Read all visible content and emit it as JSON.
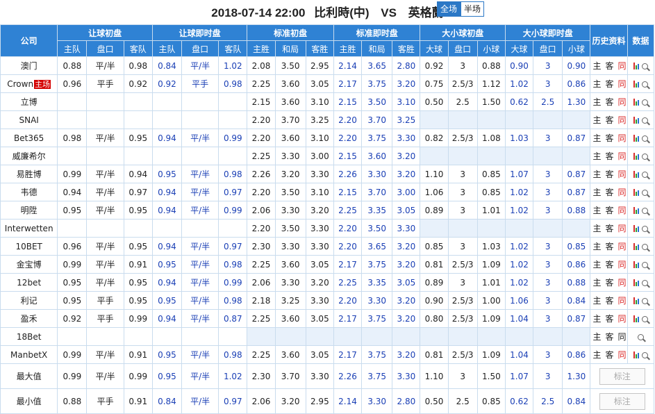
{
  "header": {
    "datetime": "2018-07-14 22:00",
    "home": "比利時(中)",
    "vs": "VS",
    "away": "英格蘭",
    "toggle_full": "全场",
    "toggle_half": "半场"
  },
  "columns": {
    "company": "公司",
    "group_handicap_init": "让球初盘",
    "group_handicap_live": "让球即时盘",
    "group_std_init": "标准初盘",
    "group_std_live": "标准即时盘",
    "group_ou_init": "大小球初盘",
    "group_ou_live": "大小球即时盘",
    "history": "历史资料",
    "data": "数据",
    "home_team": "主队",
    "line": "盘口",
    "away_team": "客队",
    "home_win": "主胜",
    "draw": "和局",
    "away_win": "客胜",
    "over": "大球",
    "under": "小球"
  },
  "history_labels": {
    "home": "主",
    "away": "客",
    "same": "同"
  },
  "rows": [
    {
      "company": "澳门",
      "hi": [
        "0.88",
        "平/半",
        "0.98"
      ],
      "hl": [
        "0.84",
        "平/半",
        "1.02"
      ],
      "si": [
        "2.08",
        "3.50",
        "2.95"
      ],
      "sl": [
        "2.14",
        "3.65",
        "2.80"
      ],
      "oi": [
        "0.92",
        "3",
        "0.88"
      ],
      "ol": [
        "0.90",
        "3",
        "0.90"
      ],
      "tong": true,
      "bars": true
    },
    {
      "company": "Crown",
      "tag": "主场",
      "hi": [
        "0.96",
        "平手",
        "0.92"
      ],
      "hl": [
        "0.92",
        "平手",
        "0.98"
      ],
      "si": [
        "2.25",
        "3.60",
        "3.05"
      ],
      "sl": [
        "2.17",
        "3.75",
        "3.20"
      ],
      "oi": [
        "0.75",
        "2.5/3",
        "1.12"
      ],
      "ol": [
        "1.02",
        "3",
        "0.86"
      ],
      "tong": true,
      "bars": true
    },
    {
      "company": "立博",
      "hi": [
        "",
        "",
        ""
      ],
      "hl": [
        "",
        "",
        ""
      ],
      "si": [
        "2.15",
        "3.60",
        "3.10"
      ],
      "sl": [
        "2.15",
        "3.50",
        "3.10"
      ],
      "oi": [
        "0.50",
        "2.5",
        "1.50"
      ],
      "ol": [
        "0.62",
        "2.5",
        "1.30"
      ],
      "tong": true,
      "bars": true
    },
    {
      "company": "SNAI",
      "hi": [
        "",
        "",
        ""
      ],
      "hl": [
        "",
        "",
        ""
      ],
      "si": [
        "2.20",
        "3.70",
        "3.25"
      ],
      "sl": [
        "2.20",
        "3.70",
        "3.25"
      ],
      "oi": [
        "",
        "",
        ""
      ],
      "ol": [
        "",
        "",
        ""
      ],
      "tong": true,
      "bars": true
    },
    {
      "company": "Bet365",
      "hi": [
        "0.98",
        "平/半",
        "0.95"
      ],
      "hl": [
        "0.94",
        "平/半",
        "0.99"
      ],
      "si": [
        "2.20",
        "3.60",
        "3.10"
      ],
      "sl": [
        "2.20",
        "3.75",
        "3.30"
      ],
      "oi": [
        "0.82",
        "2.5/3",
        "1.08"
      ],
      "ol": [
        "1.03",
        "3",
        "0.87"
      ],
      "tong": true,
      "bars": true
    },
    {
      "company": "威廉希尔",
      "hi": [
        "",
        "",
        ""
      ],
      "hl": [
        "",
        "",
        ""
      ],
      "si": [
        "2.25",
        "3.30",
        "3.00"
      ],
      "sl": [
        "2.15",
        "3.60",
        "3.20"
      ],
      "oi": [
        "",
        "",
        ""
      ],
      "ol": [
        "",
        "",
        ""
      ],
      "tong": true,
      "bars": true
    },
    {
      "company": "易胜博",
      "hi": [
        "0.99",
        "平/半",
        "0.94"
      ],
      "hl": [
        "0.95",
        "平/半",
        "0.98"
      ],
      "si": [
        "2.26",
        "3.20",
        "3.30"
      ],
      "sl": [
        "2.26",
        "3.30",
        "3.20"
      ],
      "oi": [
        "1.10",
        "3",
        "0.85"
      ],
      "ol": [
        "1.07",
        "3",
        "0.87"
      ],
      "tong": true,
      "bars": true
    },
    {
      "company": "韦德",
      "hi": [
        "0.94",
        "平/半",
        "0.97"
      ],
      "hl": [
        "0.94",
        "平/半",
        "0.97"
      ],
      "si": [
        "2.20",
        "3.50",
        "3.10"
      ],
      "sl": [
        "2.15",
        "3.70",
        "3.00"
      ],
      "oi": [
        "1.06",
        "3",
        "0.85"
      ],
      "ol": [
        "1.02",
        "3",
        "0.87"
      ],
      "tong": true,
      "bars": true
    },
    {
      "company": "明陞",
      "hi": [
        "0.95",
        "平/半",
        "0.95"
      ],
      "hl": [
        "0.94",
        "平/半",
        "0.99"
      ],
      "si": [
        "2.06",
        "3.30",
        "3.20"
      ],
      "sl": [
        "2.25",
        "3.35",
        "3.05"
      ],
      "oi": [
        "0.89",
        "3",
        "1.01"
      ],
      "ol": [
        "1.02",
        "3",
        "0.88"
      ],
      "tong": true,
      "bars": true
    },
    {
      "company": "Interwetten",
      "hi": [
        "",
        "",
        ""
      ],
      "hl": [
        "",
        "",
        ""
      ],
      "si": [
        "2.20",
        "3.50",
        "3.30"
      ],
      "sl": [
        "2.20",
        "3.50",
        "3.30"
      ],
      "oi": [
        "",
        "",
        ""
      ],
      "ol": [
        "",
        "",
        ""
      ],
      "tong": true,
      "bars": true
    },
    {
      "company": "10BET",
      "hi": [
        "0.96",
        "平/半",
        "0.95"
      ],
      "hl": [
        "0.94",
        "平/半",
        "0.97"
      ],
      "si": [
        "2.30",
        "3.30",
        "3.30"
      ],
      "sl": [
        "2.20",
        "3.65",
        "3.20"
      ],
      "oi": [
        "0.85",
        "3",
        "1.03"
      ],
      "ol": [
        "1.02",
        "3",
        "0.85"
      ],
      "tong": true,
      "bars": true
    },
    {
      "company": "金宝博",
      "hi": [
        "0.99",
        "平/半",
        "0.91"
      ],
      "hl": [
        "0.95",
        "平/半",
        "0.98"
      ],
      "si": [
        "2.25",
        "3.60",
        "3.05"
      ],
      "sl": [
        "2.17",
        "3.75",
        "3.20"
      ],
      "oi": [
        "0.81",
        "2.5/3",
        "1.09"
      ],
      "ol": [
        "1.02",
        "3",
        "0.86"
      ],
      "tong": true,
      "bars": true
    },
    {
      "company": "12bet",
      "hi": [
        "0.95",
        "平/半",
        "0.95"
      ],
      "hl": [
        "0.94",
        "平/半",
        "0.99"
      ],
      "si": [
        "2.06",
        "3.30",
        "3.20"
      ],
      "sl": [
        "2.25",
        "3.35",
        "3.05"
      ],
      "oi": [
        "0.89",
        "3",
        "1.01"
      ],
      "ol": [
        "1.02",
        "3",
        "0.88"
      ],
      "tong": true,
      "bars": true
    },
    {
      "company": "利记",
      "hi": [
        "0.95",
        "平手",
        "0.95"
      ],
      "hl": [
        "0.95",
        "平/半",
        "0.98"
      ],
      "si": [
        "2.18",
        "3.25",
        "3.30"
      ],
      "sl": [
        "2.20",
        "3.30",
        "3.20"
      ],
      "oi": [
        "0.90",
        "2.5/3",
        "1.00"
      ],
      "ol": [
        "1.06",
        "3",
        "0.84"
      ],
      "tong": true,
      "bars": true
    },
    {
      "company": "盈禾",
      "hi": [
        "0.92",
        "平手",
        "0.99"
      ],
      "hl": [
        "0.94",
        "平/半",
        "0.87"
      ],
      "si": [
        "2.25",
        "3.60",
        "3.05"
      ],
      "sl": [
        "2.17",
        "3.75",
        "3.20"
      ],
      "oi": [
        "0.80",
        "2.5/3",
        "1.09"
      ],
      "ol": [
        "1.04",
        "3",
        "0.87"
      ],
      "tong": true,
      "bars": true
    },
    {
      "company": "18Bet",
      "hi": [
        "",
        "",
        ""
      ],
      "hl": [
        "",
        "",
        ""
      ],
      "si": [
        "",
        "",
        ""
      ],
      "sl": [
        "",
        "",
        ""
      ],
      "oi": [
        "",
        "",
        ""
      ],
      "ol": [
        "",
        "",
        ""
      ],
      "tong": false,
      "bars": false
    },
    {
      "company": "ManbetX",
      "hi": [
        "0.99",
        "平/半",
        "0.91"
      ],
      "hl": [
        "0.95",
        "平/半",
        "0.98"
      ],
      "si": [
        "2.25",
        "3.60",
        "3.05"
      ],
      "sl": [
        "2.17",
        "3.75",
        "3.20"
      ],
      "oi": [
        "0.81",
        "2.5/3",
        "1.09"
      ],
      "ol": [
        "1.04",
        "3",
        "0.86"
      ],
      "tong": true,
      "bars": true
    }
  ],
  "summary": [
    {
      "label": "最大值",
      "hi": [
        "0.99",
        "平/半",
        "0.99"
      ],
      "hl": [
        "0.95",
        "平/半",
        "1.02"
      ],
      "si": [
        "2.30",
        "3.70",
        "3.30"
      ],
      "sl": [
        "2.26",
        "3.75",
        "3.30"
      ],
      "oi": [
        "1.10",
        "3",
        "1.50"
      ],
      "ol": [
        "1.07",
        "3",
        "1.30"
      ],
      "button": "标注"
    },
    {
      "label": "最小值",
      "hi": [
        "0.88",
        "平手",
        "0.91"
      ],
      "hl": [
        "0.84",
        "平/半",
        "0.97"
      ],
      "si": [
        "2.06",
        "3.20",
        "2.95"
      ],
      "sl": [
        "2.14",
        "3.30",
        "2.80"
      ],
      "oi": [
        "0.50",
        "2.5",
        "0.85"
      ],
      "ol": [
        "0.62",
        "2.5",
        "0.84"
      ],
      "button": "标注"
    }
  ]
}
